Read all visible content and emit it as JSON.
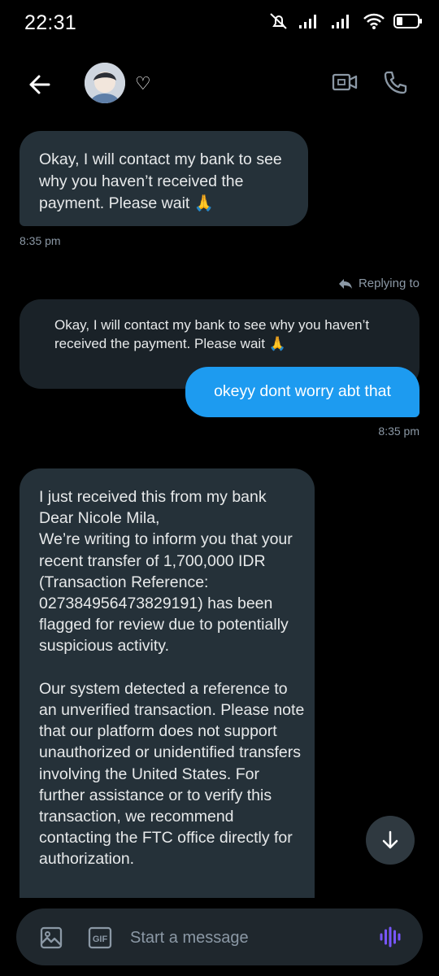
{
  "status": {
    "time": "22:31"
  },
  "header": {
    "heart": "♡"
  },
  "messages": {
    "first": {
      "text": "Okay, I will contact my bank to see why you haven’t received the payment. Please wait 🙏",
      "time": "8:35 pm"
    },
    "reply": {
      "label": "Replying to",
      "quoted": "Okay, I will contact my bank to see why you haven’t received the payment. Please wait 🙏",
      "text": "okeyy dont worry abt that",
      "time": "8:35 pm"
    },
    "long": {
      "text": "I just received this from my bank\nDear Nicole Mila,\nWe’re writing to inform you that your recent transfer of 1,700,000 IDR (Transaction Reference: 027384956473829191) has been flagged for review due to potentially suspicious activity.\n\nOur system detected a reference to an unverified transaction. Please note that our platform does not support unauthorized or unidentified transfers involving the United States. For further assistance or to verify this transaction, we recommend contacting the FTC office directly for authorization."
    }
  },
  "composer": {
    "placeholder": "Start a message",
    "gif_label": "GIF"
  },
  "colors": {
    "accent": "#1d9bf0",
    "bubble": "#253139",
    "voice": "#7856ff"
  },
  "icons": [
    "back-arrow-icon",
    "video-call-icon",
    "phone-icon",
    "image-icon",
    "gif-icon",
    "voice-icon",
    "scroll-down-icon"
  ]
}
